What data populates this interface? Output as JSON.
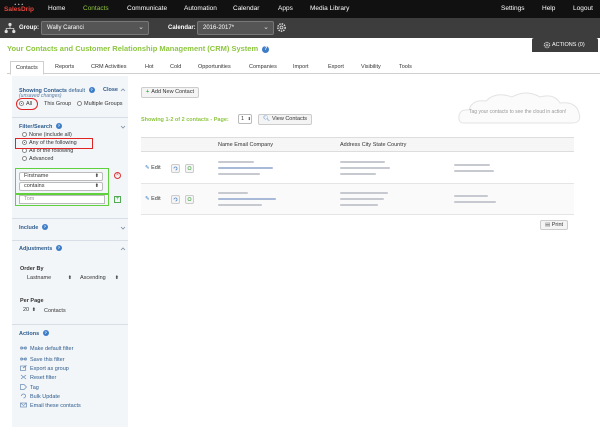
{
  "brand": {
    "logo_mark": "▲▲▲",
    "logo_text": "SalesDrip"
  },
  "nav": {
    "items": [
      {
        "label": "Home",
        "active": false
      },
      {
        "label": "Contacts",
        "active": true
      },
      {
        "label": "Communicate",
        "active": false
      },
      {
        "label": "Automation",
        "active": false
      },
      {
        "label": "Calendar",
        "active": false
      },
      {
        "label": "Apps",
        "active": false
      },
      {
        "label": "Media Library",
        "active": false
      }
    ],
    "right_items": [
      {
        "label": "Settings"
      },
      {
        "label": "Help"
      },
      {
        "label": "Logout"
      }
    ],
    "active_color": "#8dc63f"
  },
  "groupbar": {
    "group_label": "Group:",
    "group_value": "Wally Caranci",
    "calendar_label": "Calendar:",
    "calendar_value": "2016-2017*"
  },
  "page": {
    "title": "Your Contacts and Customer Relationship Management (CRM) System",
    "help": "?",
    "actions_button": "ACTIONS (0)"
  },
  "tabs": [
    {
      "label": "Contacts",
      "active": true
    },
    {
      "label": "Reports"
    },
    {
      "label": "CRM Activities"
    },
    {
      "label": "Hot"
    },
    {
      "label": "Cold"
    },
    {
      "label": "Opportunities"
    },
    {
      "label": "Companies"
    },
    {
      "label": "Import"
    },
    {
      "label": "Export"
    },
    {
      "label": "Visibility"
    },
    {
      "label": "Tools"
    }
  ],
  "sidebar": {
    "showing_title": "Showing Contacts",
    "showing_default": "default",
    "unsaved": "(unsaved changes)",
    "close": "Close",
    "scope_options": [
      {
        "label": "All",
        "selected": true
      },
      {
        "label": "This Group",
        "selected": false
      },
      {
        "label": "Multiple Groups",
        "selected": false
      }
    ],
    "filter_title": "Filter/Search",
    "filter_options": [
      {
        "label": "None (include all)",
        "selected": false
      },
      {
        "label": "Any of the following",
        "selected": true
      },
      {
        "label": "All of the following",
        "selected": false
      },
      {
        "label": "Advanced",
        "selected": false
      }
    ],
    "field_select": "Firstname",
    "operator_select": "contains",
    "value_placeholder": "Tom",
    "remove_symbol": "×",
    "add_symbol": "+",
    "include_title": "Include",
    "adjustments_title": "Adjustments",
    "order_by_label": "Order By",
    "order_field": "Lastname",
    "order_direction": "Ascending",
    "per_page_label": "Per Page",
    "per_page_value": "20",
    "per_page_unit": "Contacts",
    "actions_title": "Actions",
    "actions": [
      {
        "label": "Make default filter"
      },
      {
        "label": "Save this filter"
      },
      {
        "label": "Export as group"
      },
      {
        "label": "Reset filter"
      },
      {
        "label": "Tag"
      },
      {
        "label": "Bulk Update"
      },
      {
        "label": "Email these contacts"
      }
    ]
  },
  "main": {
    "add_contact": "Add New Contact",
    "showing_text": "Showing 1-2 of 2 contacts - Page:",
    "page_value": "1",
    "view_contacts": "View Contacts",
    "tag_cloud_text": "Tag your contacts to see the cloud in action!",
    "columns": [
      "Name Email Company",
      "Address City State Country"
    ],
    "rows": [
      {
        "edit_label": "Edit"
      },
      {
        "edit_label": "Edit"
      }
    ],
    "print": "Print"
  },
  "colors": {
    "highlight_red": "#e02424",
    "highlight_green": "#5fd13a",
    "link_blue": "#2d5b8c",
    "brand_green": "#8dc63f"
  }
}
